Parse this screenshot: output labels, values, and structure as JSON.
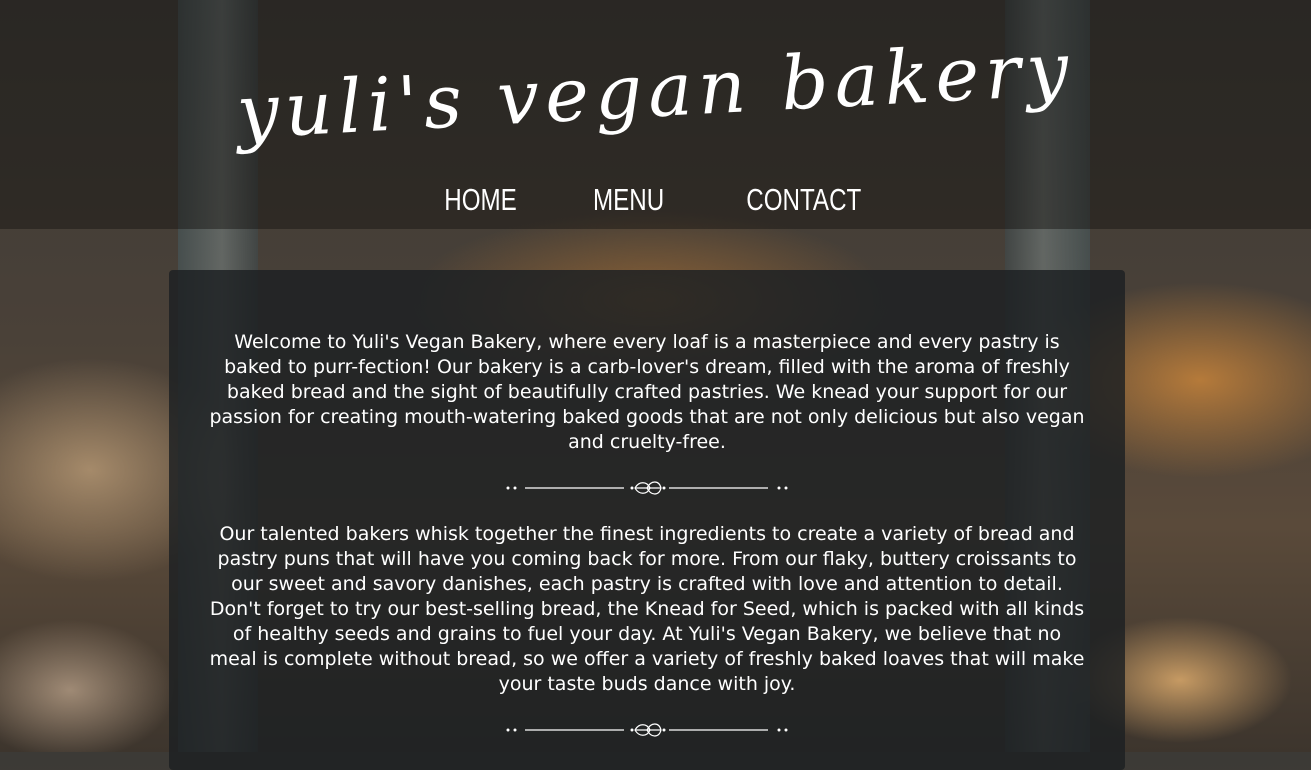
{
  "header": {
    "title": "yuli's vegan bakery",
    "nav": [
      "HOME",
      "MENU",
      "CONTACT"
    ]
  },
  "main": {
    "paragraphs": [
      "Welcome to Yuli's Vegan Bakery, where every loaf is a masterpiece and every pastry is baked to purr-fection! Our bakery is a carb-lover's dream, filled with the aroma of freshly baked bread and the sight of beautifully crafted pastries. We knead your support for our passion for creating mouth-watering baked goods that are not only delicious but also vegan and cruelty-free.",
      "Our talented bakers whisk together the finest ingredients to create a variety of bread and pastry puns that will have you coming back for more. From our flaky, buttery croissants to our sweet and savory danishes, each pastry is crafted with love and attention to detail. Don't forget to try our best-selling bread, the Knead for Seed, which is packed with all kinds of healthy seeds and grains to fuel your day. At Yuli's Vegan Bakery, we believe that no meal is complete without bread, so we offer a variety of freshly baked loaves that will make your taste buds dance with joy."
    ]
  },
  "icons": {
    "divider": "leaf-ornament-icon"
  }
}
